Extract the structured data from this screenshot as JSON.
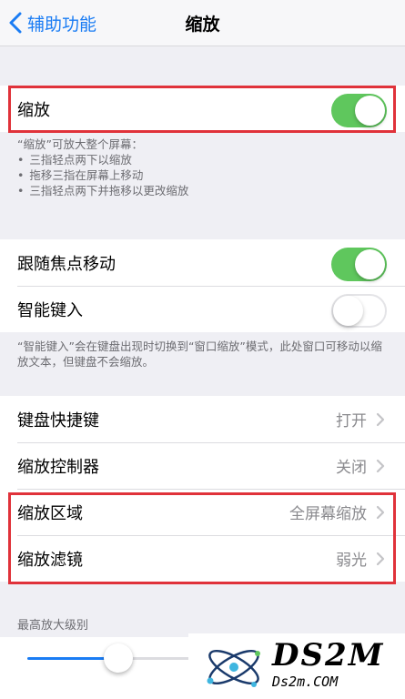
{
  "nav": {
    "back_label": "辅助功能",
    "title": "缩放"
  },
  "zoom_group": {
    "label": "缩放",
    "toggle_on": true
  },
  "zoom_footer": {
    "intro": "“缩放”可放大整个屏幕：",
    "items": [
      "三指轻点两下以缩放",
      "拖移三指在屏幕上移动",
      "三指轻点两下并拖移以更改缩放"
    ]
  },
  "focus_group": [
    {
      "label": "跟随焦点移动",
      "toggle_on": true
    },
    {
      "label": "智能键入",
      "toggle_on": false
    }
  ],
  "smart_footer": "“智能键入”会在键盘出现时切换到“窗口缩放”模式，此处窗口可移动以缩放文本，但键盘不会缩放。",
  "settings_group": [
    {
      "label": "键盘快捷键",
      "value": "打开"
    },
    {
      "label": "缩放控制器",
      "value": "关闭"
    },
    {
      "label": "缩放区域",
      "value": "全屏幕缩放"
    },
    {
      "label": "缩放滤镜",
      "value": "弱光"
    }
  ],
  "max_zoom": {
    "header": "最高放大级别",
    "slider_fraction": 0.26
  },
  "watermark": {
    "main": "DS2M",
    "sub": "Ds2m.COM"
  },
  "colors": {
    "accent": "#1a7cf4",
    "toggle_on": "#5fc75d",
    "highlight": "#e0323a"
  }
}
